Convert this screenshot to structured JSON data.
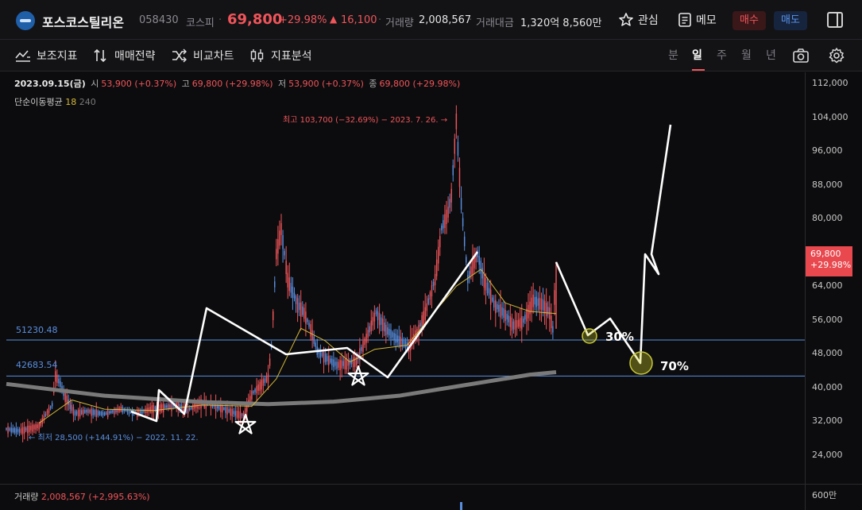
{
  "header": {
    "stock_name": "포스코스틸리온",
    "stock_code": "058430",
    "market": "코스피",
    "price": "69,800",
    "change_pct": "+29.98%",
    "change_abs": "16,100",
    "volume_label": "거래량",
    "volume_value": "2,008,567",
    "amount_label": "거래대금",
    "amount_value": "1,320억 8,560만",
    "favorite_label": "관심",
    "memo_label": "메모",
    "buy_label": "매수",
    "sell_label": "매도"
  },
  "toolbar": {
    "tools": [
      "보조지표",
      "매매전략",
      "비교차트",
      "지표분석"
    ],
    "periods": [
      "분",
      "일",
      "주",
      "월",
      "년"
    ],
    "active_period": "일"
  },
  "ohlc": {
    "date": "2023.09.15(금)",
    "open_label": "시",
    "open": "53,900",
    "open_pct": "(+0.37%)",
    "high_label": "고",
    "high": "69,800",
    "high_pct": "(+29.98%)",
    "low_label": "저",
    "low": "53,900",
    "low_pct": "(+0.37%)",
    "close_label": "종",
    "close": "69,800",
    "close_pct": "(+29.98%)"
  },
  "ma_legend": {
    "label": "단순이동평균",
    "ma1": "18",
    "ma2": "240"
  },
  "price_axis": [
    "112,000",
    "104,000",
    "96,000",
    "88,000",
    "80,000",
    "64,000",
    "56,000",
    "48,000",
    "40,000",
    "32,000",
    "24,000"
  ],
  "current_tag": {
    "price": "69,800",
    "pct": "+29.98%"
  },
  "hlines": {
    "upper": "51230.48",
    "lower": "42683.54"
  },
  "annotations": {
    "high": "최고 103,700 (−32.69%) − 2023. 7. 26. →",
    "low": "← 최저 28,500 (+144.91%) − 2022. 11. 22.",
    "pct30": "30%",
    "pct70": "70%"
  },
  "volume_panel": {
    "label": "거래량",
    "value": "2,008,567 (+2,995.63%)",
    "axis": "600만"
  },
  "colors": {
    "up": "#f0555a",
    "down": "#5a8fe0",
    "ma18": "#d4b83a",
    "ma240": "#7a7a7a",
    "drawing": "#ffffff"
  },
  "chart_data": {
    "type": "line",
    "title": "",
    "ylim": [
      20000,
      114000
    ],
    "grid": false,
    "series": [
      {
        "name": "",
        "points": [
          [
            0,
            30200
          ],
          [
            8,
            29800
          ],
          [
            15,
            30500
          ],
          [
            20,
            31000
          ],
          [
            28,
            36000
          ],
          [
            30,
            43000
          ],
          [
            33,
            41000
          ],
          [
            36,
            38000
          ],
          [
            42,
            34000
          ],
          [
            50,
            34500
          ],
          [
            60,
            33800
          ],
          [
            70,
            35000
          ],
          [
            80,
            34000
          ],
          [
            90,
            35200
          ],
          [
            100,
            35600
          ],
          [
            105,
            36000
          ],
          [
            110,
            34500
          ],
          [
            118,
            36500
          ],
          [
            125,
            36200
          ],
          [
            133,
            35000
          ],
          [
            140,
            34000
          ],
          [
            145,
            33500
          ],
          [
            150,
            38500
          ],
          [
            156,
            41000
          ],
          [
            160,
            42500
          ],
          [
            162,
            50000
          ],
          [
            165,
            72000
          ],
          [
            168,
            78000
          ],
          [
            172,
            66000
          ],
          [
            178,
            60000
          ],
          [
            182,
            58000
          ],
          [
            186,
            54000
          ],
          [
            190,
            49000
          ],
          [
            196,
            47000
          ],
          [
            202,
            45500
          ],
          [
            208,
            46000
          ],
          [
            214,
            46500
          ],
          [
            220,
            52000
          ],
          [
            226,
            58000
          ],
          [
            232,
            54000
          ],
          [
            238,
            52000
          ],
          [
            246,
            50000
          ],
          [
            252,
            54000
          ],
          [
            256,
            58000
          ],
          [
            262,
            66000
          ],
          [
            266,
            78000
          ],
          [
            270,
            82000
          ],
          [
            272,
            86000
          ],
          [
            275,
            103700
          ],
          [
            278,
            84000
          ],
          [
            282,
            66000
          ],
          [
            288,
            72000
          ],
          [
            292,
            66000
          ],
          [
            298,
            60000
          ],
          [
            304,
            58000
          ],
          [
            310,
            55000
          ],
          [
            316,
            56000
          ],
          [
            322,
            61000
          ],
          [
            328,
            60000
          ],
          [
            332,
            58000
          ],
          [
            334,
            54000
          ],
          [
            336,
            69800
          ]
        ]
      },
      {
        "name": "",
        "points": [
          [
            20,
            31500
          ],
          [
            40,
            37000
          ],
          [
            60,
            34800
          ],
          [
            90,
            34500
          ],
          [
            120,
            35800
          ],
          [
            150,
            35500
          ],
          [
            165,
            42000
          ],
          [
            180,
            54000
          ],
          [
            195,
            51000
          ],
          [
            210,
            46000
          ],
          [
            225,
            49000
          ],
          [
            245,
            50000
          ],
          [
            262,
            58000
          ],
          [
            275,
            64000
          ],
          [
            290,
            68000
          ],
          [
            305,
            60000
          ],
          [
            320,
            58000
          ],
          [
            336,
            57500
          ]
        ]
      },
      {
        "name": "",
        "points": [
          [
            0,
            40800
          ],
          [
            60,
            38000
          ],
          [
            120,
            36500
          ],
          [
            160,
            36000
          ],
          [
            200,
            36600
          ],
          [
            240,
            38000
          ],
          [
            280,
            40500
          ],
          [
            320,
            43000
          ],
          [
            336,
            43600
          ]
        ]
      }
    ]
  }
}
